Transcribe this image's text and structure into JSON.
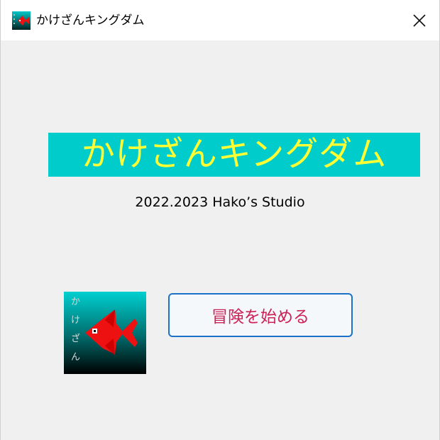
{
  "window": {
    "title": "かけざんキングダム",
    "app_icon": "fish-app-icon",
    "close_icon": "close-icon"
  },
  "main": {
    "banner_title": "かけざんキングダム",
    "copyright": "2022.2023 Hako’s Studio",
    "logo": {
      "icon": "red-fish-logo-icon",
      "text": "かけざん"
    },
    "start_button_label": "冒険を始める"
  },
  "colors": {
    "banner_bg": "#00cccc",
    "banner_text": "#ffff33",
    "button_border": "#1a73c8",
    "button_text": "#cc2255",
    "fish": "#ee1111"
  }
}
